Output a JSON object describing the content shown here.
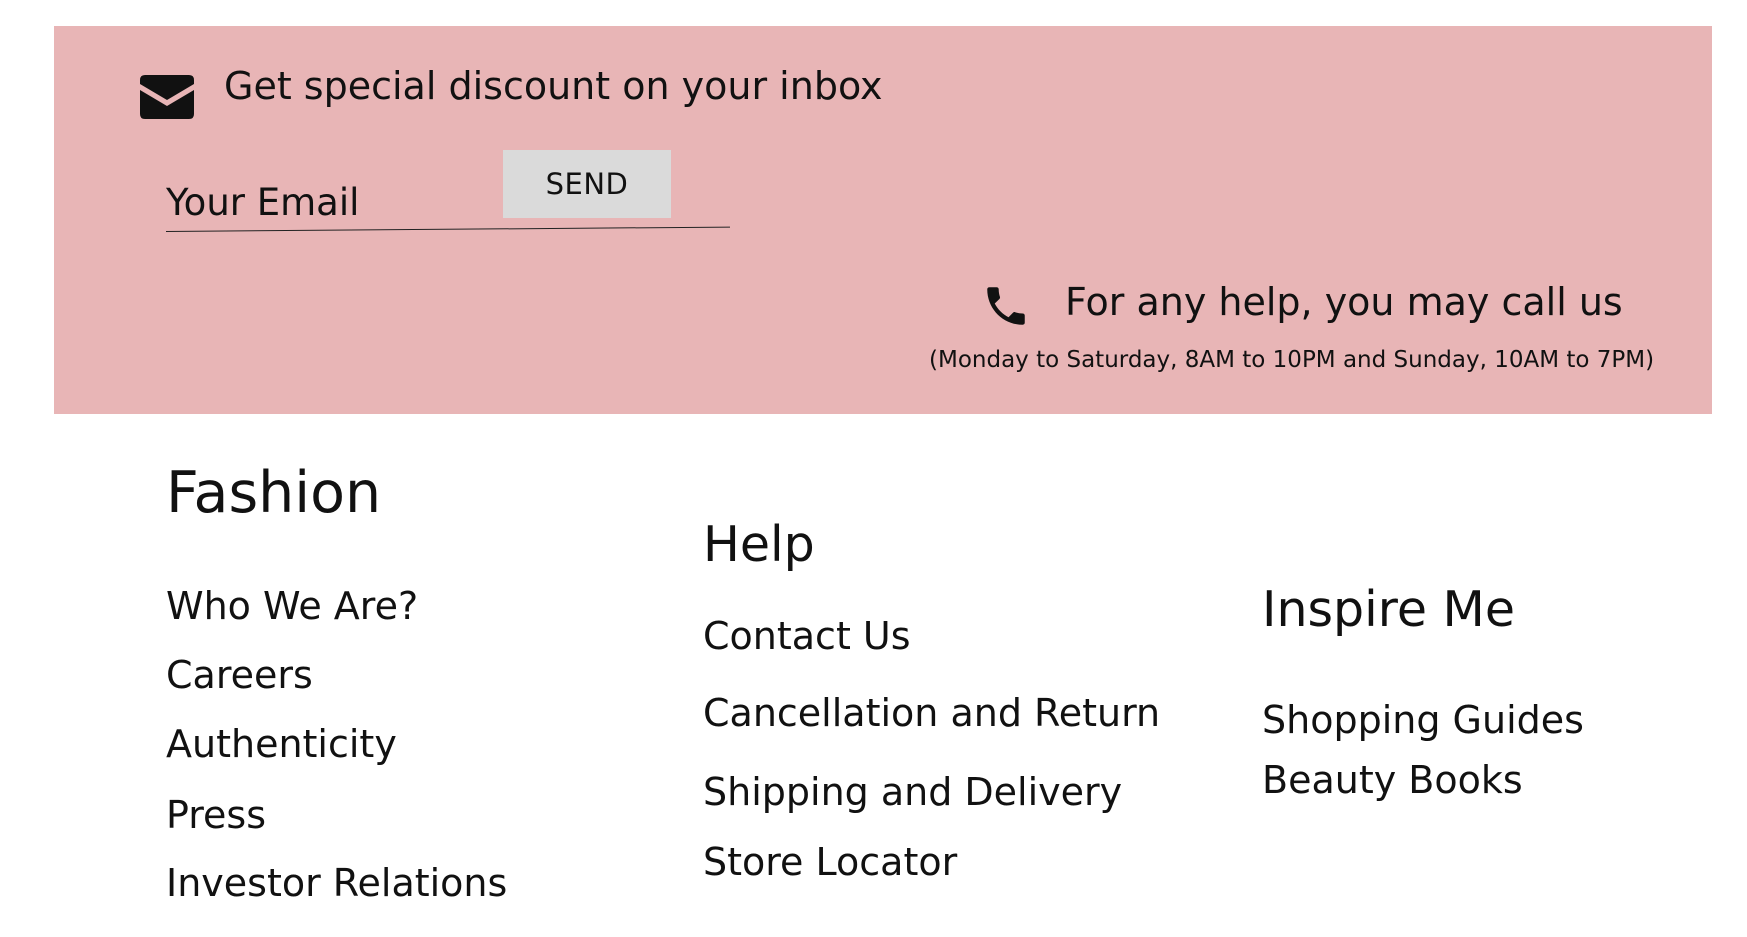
{
  "newsletter": {
    "title": "Get special discount on your inbox",
    "email_placeholder": "Your Email",
    "send_label": "SEND",
    "icon": "mail-icon"
  },
  "support": {
    "title": "For any help, you may call us",
    "hours": "(Monday to Saturday, 8AM to 10PM and Sunday, 10AM to 7PM)",
    "icon": "phone-icon"
  },
  "columns": {
    "brand": {
      "heading": "Fashion",
      "links": [
        "Who We Are?",
        "Careers",
        "Authenticity",
        "Press",
        "Investor Relations"
      ]
    },
    "help": {
      "heading": "Help",
      "links": [
        "Contact Us",
        "Cancellation and Return",
        "Shipping and Delivery",
        "Store Locator"
      ]
    },
    "inspire": {
      "heading": "Inspire Me",
      "links": [
        "Shopping Guides",
        "Beauty Books"
      ]
    }
  },
  "colors": {
    "banner_background": "#e8b5b6",
    "send_button_background": "#dadada",
    "text": "#111111"
  }
}
